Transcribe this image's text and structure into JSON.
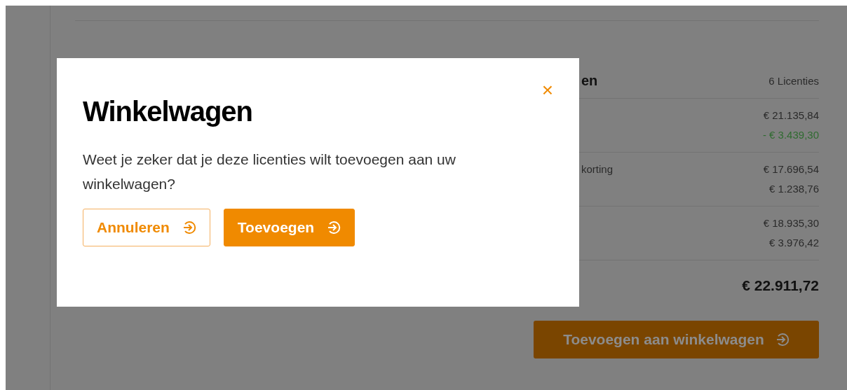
{
  "summary": {
    "heading": "en",
    "count": "6 Licenties",
    "groups": [
      {
        "rows": [
          {
            "label": "",
            "value": "€ 21.135,84",
            "kind": "plain"
          },
          {
            "label": "",
            "value": "- € 3.439,30",
            "kind": "discount"
          }
        ]
      },
      {
        "rows": [
          {
            "label": "korting",
            "value": "€ 17.696,54",
            "kind": "plain"
          },
          {
            "label": "",
            "value": "€ 1.238,76",
            "kind": "plain"
          }
        ]
      },
      {
        "rows": [
          {
            "label": "",
            "value": "€ 18.935,30",
            "kind": "plain"
          },
          {
            "label": "",
            "value": "€ 3.976,42",
            "kind": "plain"
          }
        ]
      }
    ],
    "total": "€ 22.911,72",
    "button": "Toevoegen aan winkelwagen"
  },
  "modal": {
    "title": "Winkelwagen",
    "close": "×",
    "message": "Weet je zeker dat je deze licenties wilt toevoegen aan uw winkelwagen?",
    "buttons": [
      {
        "label": "Annuleren",
        "kind": "secondary"
      },
      {
        "label": "Toevoegen",
        "kind": "primary"
      }
    ]
  }
}
